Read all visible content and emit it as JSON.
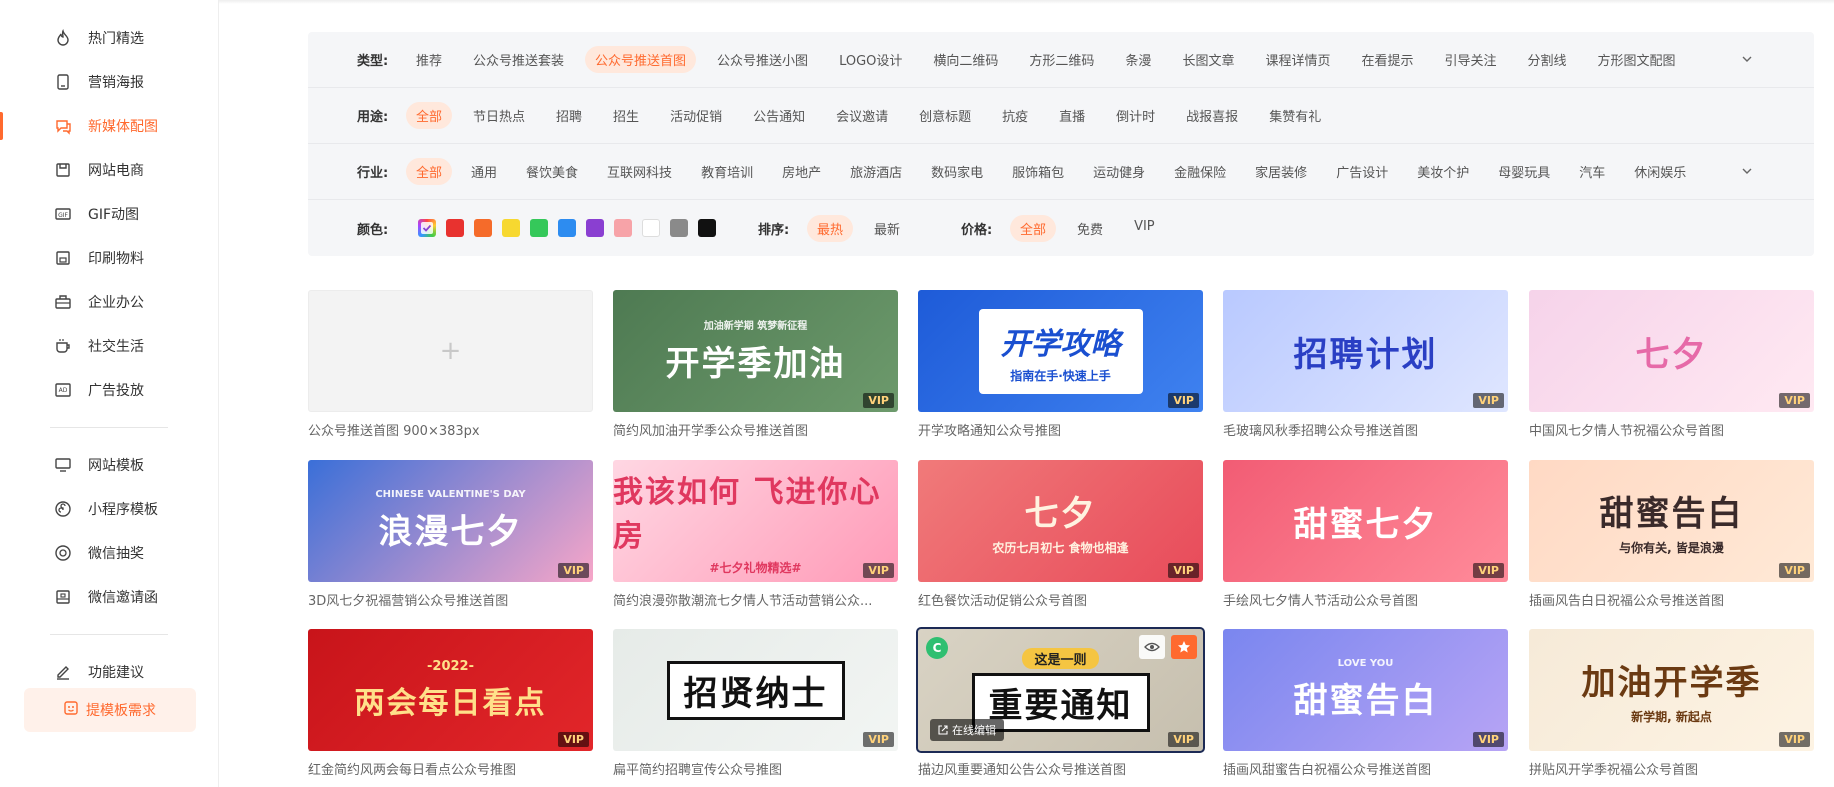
{
  "sidebar": {
    "items": [
      {
        "label": "热门精选",
        "icon": "flame-icon"
      },
      {
        "label": "营销海报",
        "icon": "phone-icon"
      },
      {
        "label": "新媒体配图",
        "icon": "chat-icon",
        "active": true
      },
      {
        "label": "网站电商",
        "icon": "bag-icon"
      },
      {
        "label": "GIF动图",
        "icon": "gif-icon"
      },
      {
        "label": "印刷物料",
        "icon": "printer-icon"
      },
      {
        "label": "企业办公",
        "icon": "briefcase-icon"
      },
      {
        "label": "社交生活",
        "icon": "cup-icon"
      },
      {
        "label": "广告投放",
        "icon": "ad-icon"
      }
    ],
    "items2": [
      {
        "label": "网站模板",
        "icon": "monitor-icon"
      },
      {
        "label": "小程序模板",
        "icon": "miniapp-icon"
      },
      {
        "label": "微信抽奖",
        "icon": "lottery-icon"
      },
      {
        "label": "微信邀请函",
        "icon": "invite-icon"
      }
    ],
    "items3": [
      {
        "label": "功能建议",
        "icon": "edit-icon"
      }
    ],
    "request_button": "提模板需求"
  },
  "filters": {
    "type": {
      "label": "类型:",
      "options": [
        "推荐",
        "公众号推送套装",
        "公众号推送首图",
        "公众号推送小图",
        "LOGO设计",
        "横向二维码",
        "方形二维码",
        "条漫",
        "长图文章",
        "课程详情页",
        "在看提示",
        "引导关注",
        "分割线",
        "方形图文配图"
      ],
      "selected": 2
    },
    "usage": {
      "label": "用途:",
      "options": [
        "全部",
        "节日热点",
        "招聘",
        "招生",
        "活动促销",
        "公告通知",
        "会议邀请",
        "创意标题",
        "抗疫",
        "直播",
        "倒计时",
        "战报喜报",
        "集赞有礼"
      ],
      "selected": 0
    },
    "industry": {
      "label": "行业:",
      "options": [
        "全部",
        "通用",
        "餐饮美食",
        "互联网科技",
        "教育培训",
        "房地产",
        "旅游酒店",
        "数码家电",
        "服饰箱包",
        "运动健身",
        "金融保险",
        "家居装修",
        "广告设计",
        "美妆个护",
        "母婴玩具",
        "汽车",
        "休闲娱乐"
      ],
      "selected": 0
    },
    "color": {
      "label": "颜色:",
      "swatches": [
        "#e8e8e8",
        "#e8322f",
        "#f56b2a",
        "#f7d830",
        "#35c85a",
        "#2d8cf0",
        "#8a3fd1",
        "#f7a3a8",
        "#ffffff",
        "#8a8a8a",
        "#111111"
      ]
    },
    "sort": {
      "label": "排序:",
      "options": [
        "最热",
        "最新"
      ],
      "selected": 0
    },
    "price": {
      "label": "价格:",
      "options": [
        "全部",
        "免费",
        "VIP"
      ],
      "selected": 0
    }
  },
  "vip_label": "VIP",
  "edit_label": "在线编辑",
  "cards": [
    {
      "caption": "公众号推送首图 900×383px",
      "title": "",
      "bg": "blank"
    },
    {
      "caption": "简约风加油开学季公众号推送首图",
      "title": "开学季加油",
      "sub": "加油新学期 筑梦新征程",
      "bg": "linear-gradient(135deg,#4e7a52,#6d9a6c)",
      "fg": "#ffffff"
    },
    {
      "caption": "开学攻略通知公众号推图",
      "title": "开学攻略",
      "sub": "指南在手·快速上手",
      "bg": "linear-gradient(135deg,#1e5bd8,#3f82f0)",
      "fg": "#1a4fd0",
      "panel": "#ffffff"
    },
    {
      "caption": "毛玻璃风秋季招聘公众号推送首图",
      "title": "招聘计划",
      "bg": "linear-gradient(135deg,#b9c9ff,#dfe6ff)",
      "fg": "#2a3fc4"
    },
    {
      "caption": "中国风七夕情人节祝福公众号首图",
      "title": "七夕",
      "bg": "linear-gradient(135deg,#f6d3ea,#ffe9f2)",
      "fg": "#e66aa8"
    },
    {
      "caption": "3D风七夕祝福营销公众号推送首图",
      "title": "浪漫七夕",
      "sub": "CHINESE VALENTINE'S DAY",
      "bg": "linear-gradient(135deg,#3a6fd8,#f7a6c8)",
      "fg": "#ffffff"
    },
    {
      "caption": "简约浪漫弥散潮流七夕情人节活动营销公众...",
      "title": "我该如何 飞进你心房",
      "sub": "#七夕礼物精选#",
      "bg": "linear-gradient(135deg,#ffd7e3,#ff9ab7)",
      "fg": "#e0385f"
    },
    {
      "caption": "红色餐饮活动促销公众号首图",
      "title": "七夕",
      "sub": "农历七月初七 食物也相逢",
      "bg": "linear-gradient(135deg,#f07a7a,#e84b5a)",
      "fg": "#fff2e0"
    },
    {
      "caption": "手绘风七夕情人节活动公众号首图",
      "title": "甜蜜七夕",
      "bg": "linear-gradient(135deg,#f25c74,#ff8b9a)",
      "fg": "#ffffff"
    },
    {
      "caption": "插画风告白日祝福公众号推送首图",
      "title": "甜蜜告白",
      "sub": "与你有关, 皆是浪漫",
      "bg": "linear-gradient(135deg,#ffd9c4,#ffe9d6)",
      "fg": "#3a2a2a"
    },
    {
      "caption": "红金简约风两会每日看点公众号推图",
      "title": "两会每日看点",
      "sub": "-2022-",
      "bg": "linear-gradient(135deg,#c8141a,#e2262a)",
      "fg": "#ffe08a"
    },
    {
      "caption": "扁平简约招聘宣传公众号推图",
      "title": "招贤纳士",
      "bg": "linear-gradient(135deg,#e6ebe8,#f2f5f3)",
      "fg": "#1a1a1a"
    },
    {
      "caption": "描边风重要通知公告公众号推送首图",
      "title": "重要通知",
      "sub": "这是一则",
      "bg": "linear-gradient(135deg,#d9d3c4,#c6bfae)",
      "fg": "#111111",
      "hover": true
    },
    {
      "caption": "插画风甜蜜告白祝福公众号推送首图",
      "title": "甜蜜告白",
      "sub": "LOVE YOU",
      "bg": "linear-gradient(135deg,#7a86ef,#b7a4f5)",
      "fg": "#ffffff"
    },
    {
      "caption": "拼贴风开学季祝福公众号首图",
      "title": "加油开学季",
      "sub": "新学期, 新起点",
      "bg": "linear-gradient(135deg,#f6ead8,#fdf3e3)",
      "fg": "#6b3a12"
    }
  ]
}
